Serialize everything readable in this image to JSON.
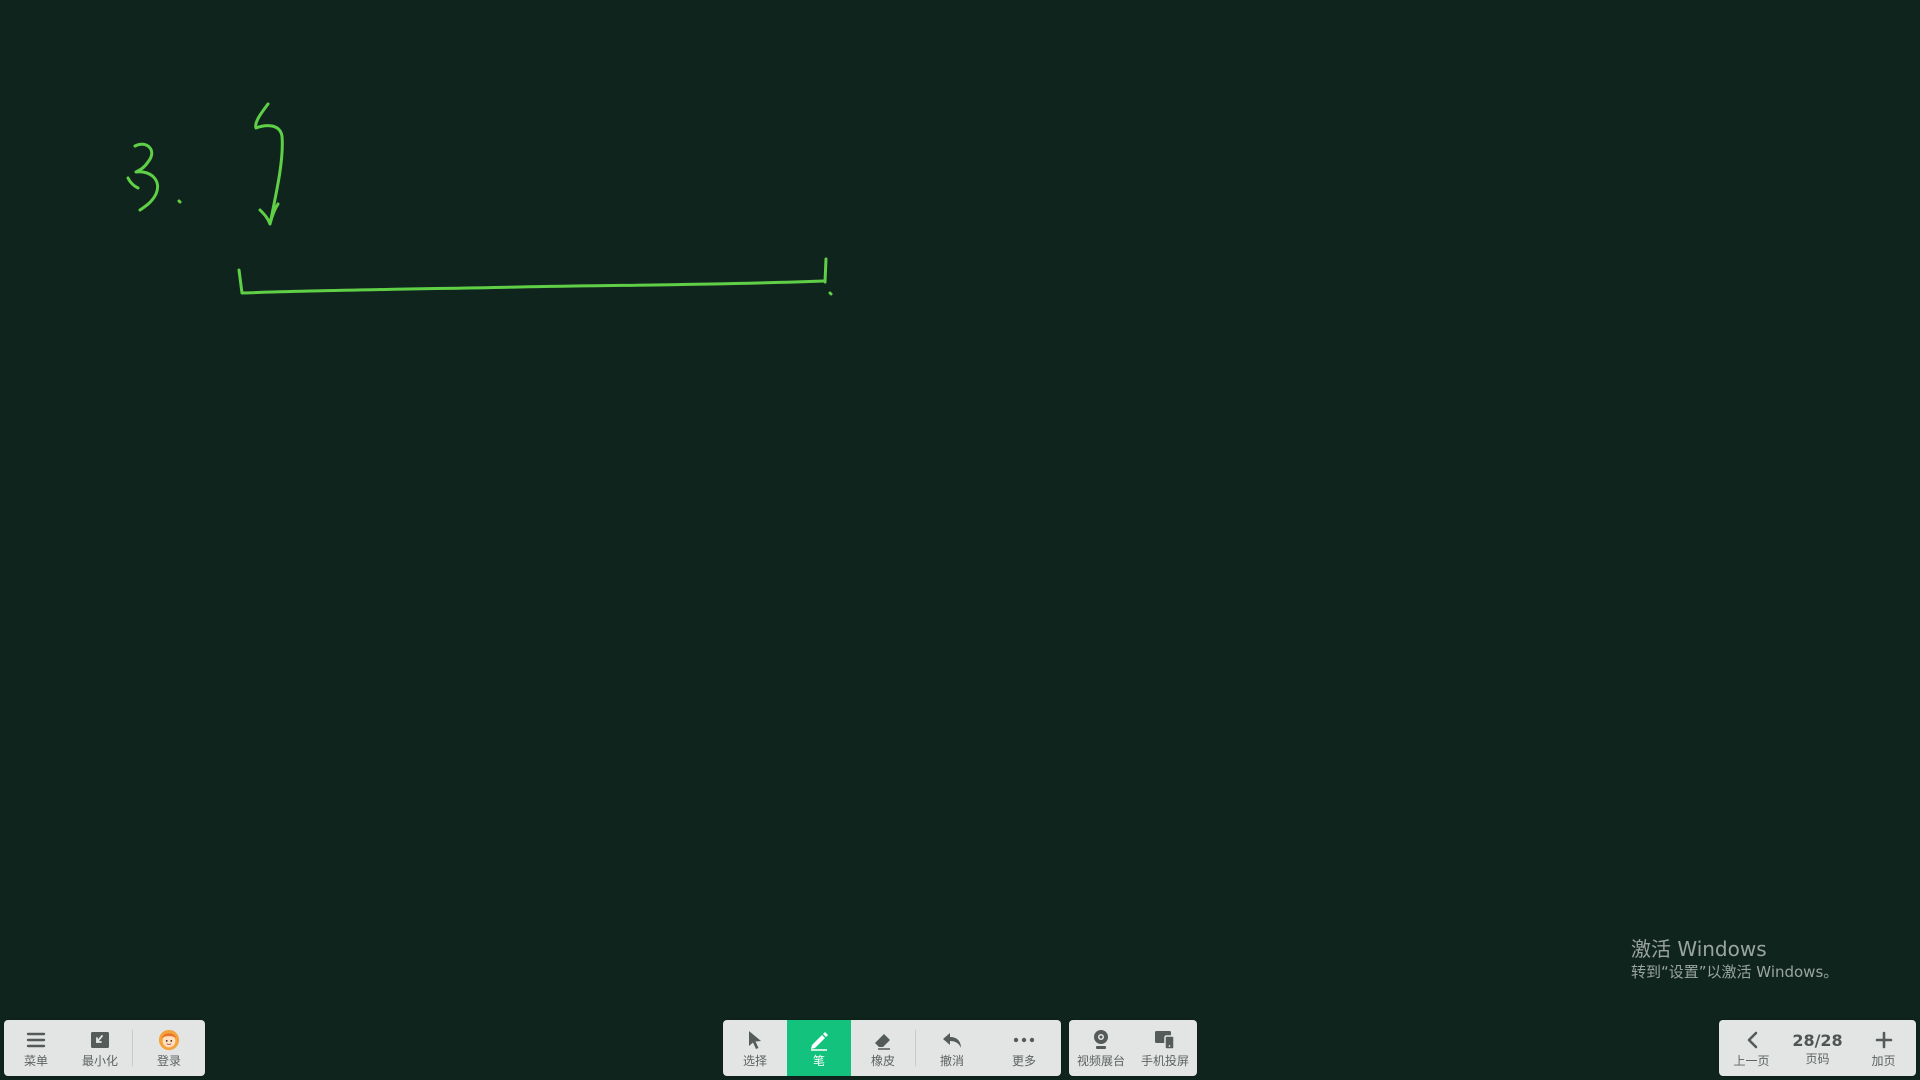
{
  "colors": {
    "board_background": "#10241e",
    "ink": "#5fd046",
    "toolbar_background": "#e3e5e4",
    "active_tool": "#13c27d"
  },
  "left_toolbar": {
    "menu": {
      "label": "菜单",
      "icon": "hamburger-menu-icon"
    },
    "minimize": {
      "label": "最小化",
      "icon": "minimize-icon"
    },
    "login": {
      "label": "登录",
      "icon": "avatar-icon"
    }
  },
  "center_toolbar": {
    "select": {
      "label": "选择",
      "icon": "cursor-arrow-icon"
    },
    "pen": {
      "label": "笔",
      "icon": "pen-icon",
      "active": true
    },
    "eraser": {
      "label": "橡皮",
      "icon": "eraser-icon"
    },
    "undo": {
      "label": "撤消",
      "icon": "undo-arrow-icon"
    },
    "more": {
      "label": "更多",
      "icon": "ellipsis-icon"
    }
  },
  "media_toolbar": {
    "video_booth": {
      "label": "视频展台",
      "icon": "camera-icon"
    },
    "phone_cast": {
      "label": "手机投屏",
      "icon": "phone-cast-icon"
    }
  },
  "page_toolbar": {
    "prev": {
      "label": "上一页",
      "icon": "chevron-left-icon"
    },
    "page": {
      "value": "28/28",
      "label": "页码"
    },
    "add": {
      "label": "加页",
      "icon": "plus-icon"
    }
  },
  "watermark": {
    "line1": "激活 Windows",
    "line2": "转到“设置”以激活 Windows。"
  }
}
